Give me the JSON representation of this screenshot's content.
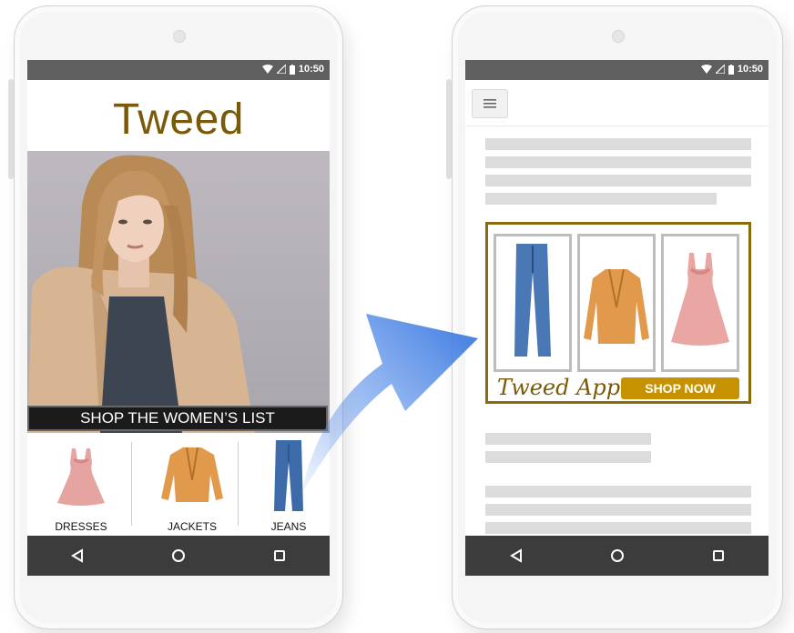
{
  "status_bar": {
    "time": "10:50"
  },
  "left_phone": {
    "brand_title": "Tweed",
    "hero_banner": "SHOP THE WOMEN’S LIST",
    "categories": [
      {
        "label": "DRESSES",
        "icon": "dress-icon"
      },
      {
        "label": "JACKETS",
        "icon": "jacket-icon"
      },
      {
        "label": "JEANS",
        "icon": "jeans-icon"
      }
    ]
  },
  "right_phone": {
    "ad": {
      "brand": "Tweed Apparel",
      "cta": "SHOP NOW",
      "products": [
        "jeans-icon",
        "jacket-icon",
        "dress-icon"
      ]
    }
  },
  "colors": {
    "brand": "#7a5a08",
    "cta": "#c69200",
    "arrow": "#4a86e8",
    "status_bar": "#5f5f5f",
    "nav_bar": "#3c3c3c"
  },
  "icons": {
    "nav": [
      "back-icon",
      "home-icon",
      "recents-icon"
    ],
    "status": [
      "wifi-icon",
      "signal-icon",
      "battery-icon"
    ],
    "menu": "hamburger-menu-icon"
  }
}
